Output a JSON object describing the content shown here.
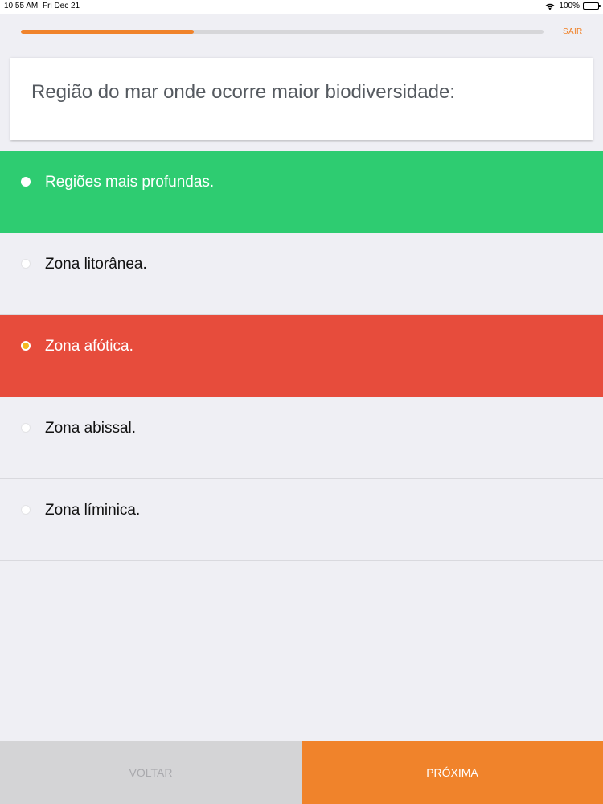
{
  "status_bar": {
    "time": "10:55 AM",
    "date": "Fri Dec 21",
    "battery": "100%",
    "icons": [
      "wifi-icon",
      "battery-icon"
    ]
  },
  "progress": {
    "fraction": 0.33,
    "color": "#f0832b"
  },
  "header": {
    "exit_label": "SAIR"
  },
  "question": {
    "text": "Região do mar onde ocorre maior biodiversidade:"
  },
  "options": [
    {
      "label": "Regiões mais profundas.",
      "state": "correct"
    },
    {
      "label": "Zona litorânea.",
      "state": "default"
    },
    {
      "label": "Zona afótica.",
      "state": "wrong"
    },
    {
      "label": "Zona abissal.",
      "state": "default"
    },
    {
      "label": "Zona líminica.",
      "state": "default"
    }
  ],
  "colors": {
    "accent": "#f0832b",
    "correct": "#2ecc71",
    "wrong": "#e74c3c",
    "background": "#efeff4"
  },
  "footer": {
    "back_label": "VOLTAR",
    "next_label": "PRÓXIMA"
  }
}
